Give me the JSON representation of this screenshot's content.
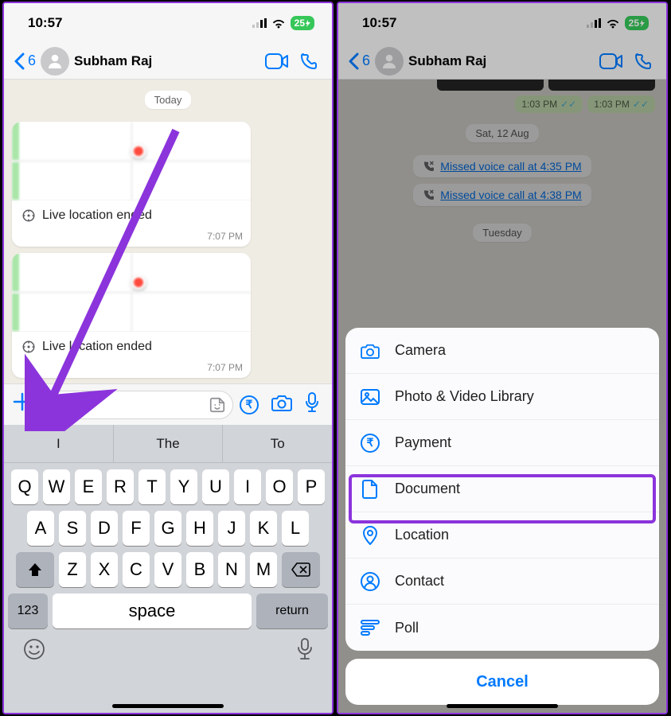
{
  "status": {
    "time": "10:57",
    "battery": "25"
  },
  "header": {
    "back_count": "6",
    "contact_name": "Subham Raj"
  },
  "left": {
    "date_label": "Today",
    "loc1": {
      "label": "Live location ended",
      "time": "7:07 PM"
    },
    "loc2": {
      "label": "Live location ended",
      "time": "7:07 PM"
    },
    "suggest": [
      "I",
      "The",
      "To"
    ],
    "row1": [
      "Q",
      "W",
      "E",
      "R",
      "T",
      "Y",
      "U",
      "I",
      "O",
      "P"
    ],
    "row2": [
      "A",
      "S",
      "D",
      "F",
      "G",
      "H",
      "J",
      "K",
      "L"
    ],
    "row3": [
      "Z",
      "X",
      "C",
      "V",
      "B",
      "N",
      "M"
    ],
    "num_key": "123",
    "space_key": "space",
    "return_key": "return"
  },
  "right": {
    "photo_time1": "1:03 PM",
    "photo_time2": "1:03 PM",
    "date_label": "Sat, 12 Aug",
    "miss1": "Missed voice call at 4:35 PM",
    "miss2": "Missed voice call at 4:38 PM",
    "date_label2": "Tuesday",
    "sheet": {
      "camera": "Camera",
      "library": "Photo & Video Library",
      "payment": "Payment",
      "document": "Document",
      "location": "Location",
      "contact": "Contact",
      "poll": "Poll",
      "cancel": "Cancel"
    }
  }
}
